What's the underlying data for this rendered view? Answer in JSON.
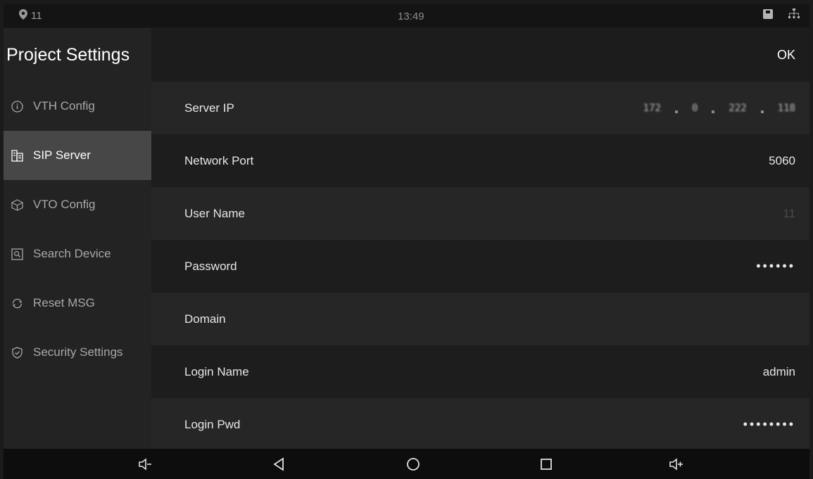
{
  "status_bar": {
    "location_count": "11",
    "time": "13:49",
    "icons": [
      "location-pin-icon",
      "sd-card-icon",
      "network-icon"
    ]
  },
  "sidebar": {
    "title": "Project Settings",
    "items": [
      {
        "label": "VTH Config",
        "icon": "info-circle-icon",
        "active": false
      },
      {
        "label": "SIP Server",
        "icon": "building-icon",
        "active": true
      },
      {
        "label": "VTO Config",
        "icon": "cube-icon",
        "active": false
      },
      {
        "label": "Search Device",
        "icon": "search-box-icon",
        "active": false
      },
      {
        "label": "Reset MSG",
        "icon": "reset-icon",
        "active": false
      },
      {
        "label": "Security Settings",
        "icon": "shield-check-icon",
        "active": false
      }
    ]
  },
  "header": {
    "ok_label": "OK"
  },
  "form": {
    "rows": [
      {
        "label": "Server IP",
        "value_parts": [
          "172",
          "0",
          "222",
          "118"
        ]
      },
      {
        "label": "Network Port",
        "value": "5060"
      },
      {
        "label": "User Name",
        "value": "11"
      },
      {
        "label": "Password",
        "value": "••••••"
      },
      {
        "label": "Domain",
        "value": ""
      },
      {
        "label": "Login Name",
        "value": "admin"
      },
      {
        "label": "Login Pwd",
        "value": "••••••••"
      }
    ]
  },
  "nav_bar": {
    "icons": [
      "volume-down-icon",
      "back-icon",
      "home-icon",
      "recents-icon",
      "volume-up-icon"
    ]
  },
  "colors": {
    "background": "#1b1b1b",
    "sidebar_active": "#474747",
    "text": "#e6e6e6"
  }
}
